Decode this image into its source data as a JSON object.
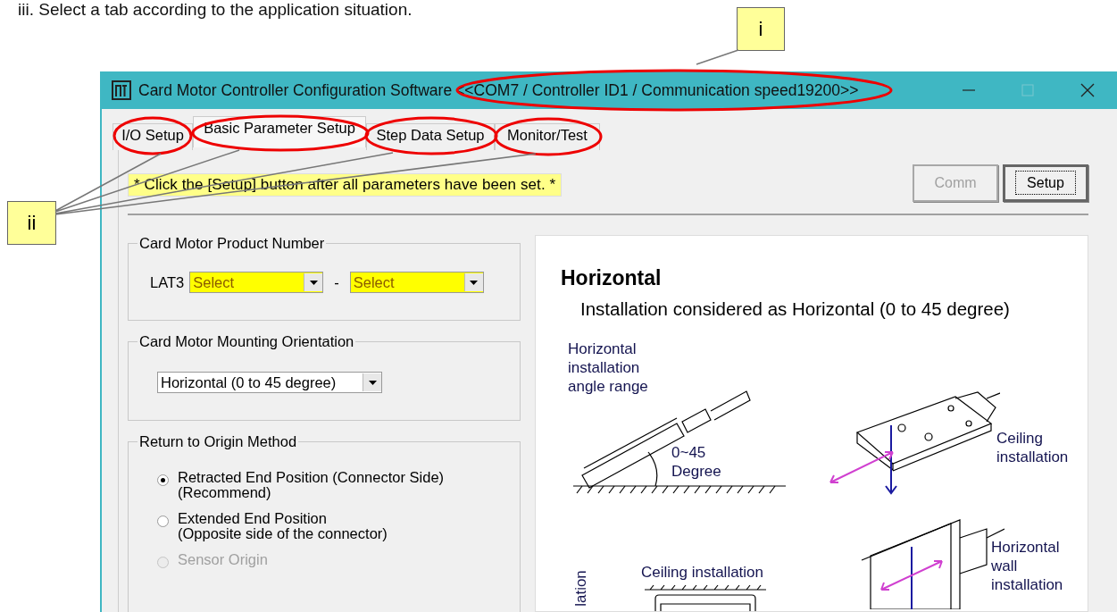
{
  "instruction": "iii. Select a tab according to the application situation.",
  "callouts": [
    {
      "label": "i"
    },
    {
      "label": "ii"
    }
  ],
  "window": {
    "title": "Card Motor Controller Configuration Software",
    "connection": "<<COM7 / Controller ID1 / Communication speed19200>>"
  },
  "tabs": [
    {
      "label": "I/O Setup",
      "selected": false
    },
    {
      "label": "Basic Parameter Setup",
      "selected": true
    },
    {
      "label": "Step Data Setup",
      "selected": false
    },
    {
      "label": "Monitor/Test",
      "selected": false
    }
  ],
  "note": "* Click the [Setup] button after all parameters have been set. *",
  "buttons": [
    {
      "label": "Comm",
      "disabled": true,
      "default": false
    },
    {
      "label": "Setup",
      "disabled": false,
      "default": true
    }
  ],
  "product_number": {
    "title": "Card Motor Product Number",
    "prefix": "LAT3",
    "separator": "-",
    "selects": [
      {
        "value": "Select"
      },
      {
        "value": "Select"
      }
    ]
  },
  "mounting": {
    "title": "Card Motor Mounting Orientation",
    "value": "Horizontal (0 to 45 degree)"
  },
  "origin": {
    "title": "Return to Origin Method",
    "options": [
      {
        "label": "Retracted End Position (Connector Side)",
        "note": "(Recommend)",
        "selected": true,
        "disabled": false
      },
      {
        "label": "Extended End Position",
        "note": "(Opposite side of the connector)",
        "selected": false,
        "disabled": false
      },
      {
        "label": "Sensor Origin",
        "selected": false,
        "disabled": true
      }
    ]
  },
  "preview": {
    "heading": "Horizontal",
    "subtitle": "Installation considered as Horizontal (0 to 45 degree)",
    "angle_range_label": "Horizontal installation angle range",
    "angle_label": "0~45 Degree",
    "ceiling_label": "Ceiling installation",
    "wall_label": "Horizontal wall installation",
    "ceiling_label_2": "Ceiling installation",
    "cut_label": "lation"
  }
}
